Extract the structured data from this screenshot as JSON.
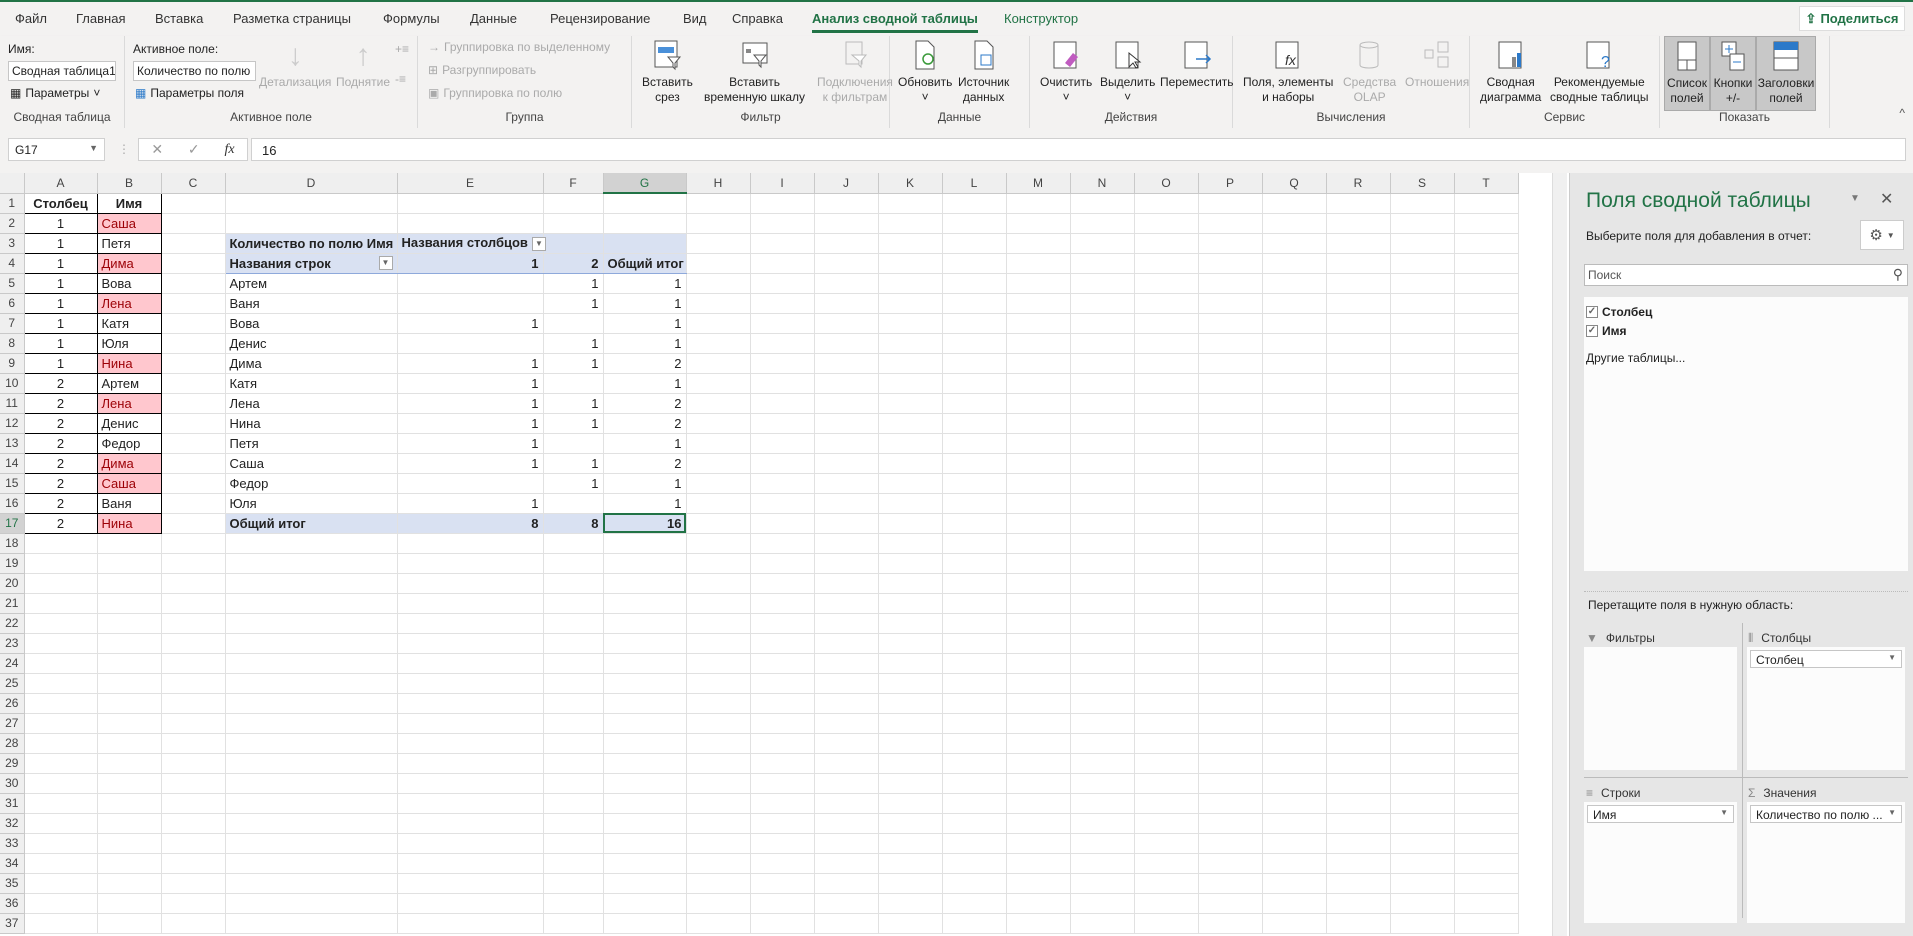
{
  "tabs": [
    "Файл",
    "Главная",
    "Вставка",
    "Разметка страницы",
    "Формулы",
    "Данные",
    "Рецензирование",
    "Вид",
    "Справка",
    "Анализ сводной таблицы",
    "Конструктор"
  ],
  "share_label": "Поделиться",
  "ribbon": {
    "pivot": {
      "name_label": "Имя:",
      "name_value": "Сводная таблица1",
      "params": "Параметры",
      "group": "Сводная таблица"
    },
    "active": {
      "label": "Активное поле:",
      "value": "Количество по полю",
      "params": "Параметры поля",
      "drill_down": "Детализация",
      "drill_up": "Поднятие",
      "group": "Активное поле"
    },
    "grouping": {
      "group_selection": "Группировка по выделенному",
      "ungroup": "Разгруппировать",
      "group_field": "Группировка по полю",
      "group": "Группа"
    },
    "filter": {
      "slicer": [
        "Вставить",
        "срез"
      ],
      "timeline": [
        "Вставить",
        "временную шкалу"
      ],
      "connections": [
        "Подключения",
        "к фильтрам"
      ],
      "group": "Фильтр"
    },
    "data": {
      "refresh": "Обновить",
      "source": [
        "Источник",
        "данных"
      ],
      "group": "Данные"
    },
    "actions": {
      "clear": "Очистить",
      "select": "Выделить",
      "move": "Переместить",
      "group": "Действия"
    },
    "calc": {
      "fields": [
        "Поля, элементы",
        "и наборы"
      ],
      "olap": [
        "Средства",
        "OLAP"
      ],
      "relations": "Отношения",
      "group": "Вычисления"
    },
    "service": {
      "chart": [
        "Сводная",
        "диаграмма"
      ],
      "recommended": [
        "Рекомендуемые",
        "сводные таблицы"
      ],
      "group": "Сервис"
    },
    "show": {
      "field_list": [
        "Список",
        "полей"
      ],
      "buttons": [
        "Кнопки",
        "+/-"
      ],
      "headers": [
        "Заголовки",
        "полей"
      ],
      "group": "Показать"
    }
  },
  "formula": {
    "name_box": "G17",
    "value": "16"
  },
  "columns": [
    "A",
    "B",
    "C",
    "D",
    "E",
    "F",
    "G",
    "H",
    "I",
    "J",
    "K",
    "L",
    "M",
    "N",
    "O",
    "P",
    "Q",
    "R",
    "S",
    "T"
  ],
  "selected_col": "G",
  "selected_row": 17,
  "source": {
    "headers": [
      "Столбец",
      "Имя"
    ],
    "rows": [
      [
        1,
        "Саша",
        true
      ],
      [
        1,
        "Петя",
        false
      ],
      [
        1,
        "Дима",
        true
      ],
      [
        1,
        "Вова",
        false
      ],
      [
        1,
        "Лена",
        true
      ],
      [
        1,
        "Катя",
        false
      ],
      [
        1,
        "Юля",
        false
      ],
      [
        1,
        "Нина",
        true
      ],
      [
        2,
        "Артем",
        false
      ],
      [
        2,
        "Лена",
        true
      ],
      [
        2,
        "Денис",
        false
      ],
      [
        2,
        "Федор",
        false
      ],
      [
        2,
        "Дима",
        true
      ],
      [
        2,
        "Саша",
        true
      ],
      [
        2,
        "Ваня",
        false
      ],
      [
        2,
        "Нина",
        true
      ]
    ]
  },
  "pivot": {
    "value_caption": "Количество по полю Имя",
    "col_caption": "Названия столбцов",
    "row_caption": "Названия строк",
    "col_keys": [
      "1",
      "2"
    ],
    "total_label": "Общий итог",
    "rows": [
      [
        "Артем",
        "",
        "1",
        "1"
      ],
      [
        "Ваня",
        "",
        "1",
        "1"
      ],
      [
        "Вова",
        "1",
        "",
        "1"
      ],
      [
        "Денис",
        "",
        "1",
        "1"
      ],
      [
        "Дима",
        "1",
        "1",
        "2"
      ],
      [
        "Катя",
        "1",
        "",
        "1"
      ],
      [
        "Лена",
        "1",
        "1",
        "2"
      ],
      [
        "Нина",
        "1",
        "1",
        "2"
      ],
      [
        "Петя",
        "1",
        "",
        "1"
      ],
      [
        "Саша",
        "1",
        "1",
        "2"
      ],
      [
        "Федор",
        "",
        "1",
        "1"
      ],
      [
        "Юля",
        "1",
        "",
        "1"
      ]
    ],
    "totals": [
      "8",
      "8",
      "16"
    ]
  },
  "panel": {
    "title": "Поля сводной таблицы",
    "subtitle": "Выберите поля для добавления в отчет:",
    "search_placeholder": "Поиск",
    "fields": [
      "Столбец",
      "Имя"
    ],
    "other_tables": "Другие таблицы...",
    "drag_hint": "Перетащите поля в нужную область:",
    "areas": {
      "filters": "Фильтры",
      "columns": "Столбцы",
      "rows": "Строки",
      "values": "Значения"
    },
    "columns_items": [
      "Столбец"
    ],
    "rows_items": [
      "Имя"
    ],
    "values_items": [
      "Количество по полю ..."
    ]
  }
}
